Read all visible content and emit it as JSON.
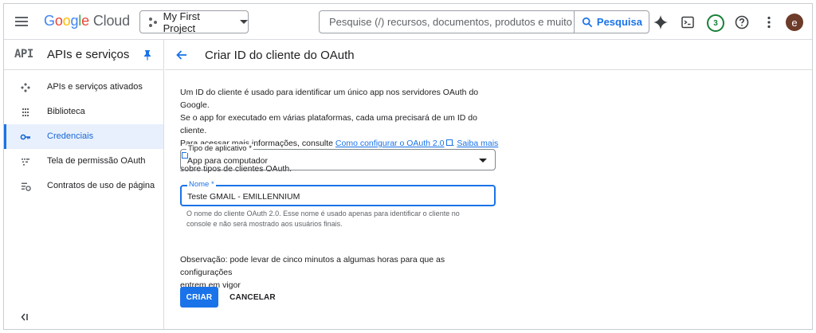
{
  "topbar": {
    "logo_google": [
      "G",
      "o",
      "o",
      "g",
      "l",
      "e"
    ],
    "logo_cloud": "Cloud",
    "project_label": "My First Project",
    "search_placeholder": "Pesquise (/) recursos, documentos, produtos e muito mais",
    "search_button_label": "Pesquisa",
    "notifications_count": "3",
    "avatar_initial": "e"
  },
  "sidebar": {
    "api_badge": "API",
    "title": "APIs e serviços",
    "items": [
      {
        "label": "APIs e serviços ativados",
        "icon": "api-hub-icon",
        "active": false
      },
      {
        "label": "Biblioteca",
        "icon": "library-grid-icon",
        "active": false
      },
      {
        "label": "Credenciais",
        "icon": "key-icon",
        "active": true
      },
      {
        "label": "Tela de permissão OAuth",
        "icon": "consent-screen-icon",
        "active": false
      },
      {
        "label": "Contratos de uso de página",
        "icon": "settings-list-icon",
        "active": false
      }
    ]
  },
  "main": {
    "title": "Criar ID do cliente do OAuth",
    "description": {
      "line1": "Um ID do cliente é usado para identificar um único app nos servidores OAuth do Google.",
      "line2": "Se o app for executado em várias plataformas, cada uma precisará de um ID do cliente.",
      "line3_prefix": "Para acessar mais informações, consulte ",
      "link1": "Como configurar o OAuth 2.0",
      "link2": "Saiba mais",
      "line4": "sobre tipos de clientes OAuth."
    },
    "app_type": {
      "label": "Tipo de aplicativo *",
      "value": "App para computador"
    },
    "name_field": {
      "label": "Nome *",
      "value": "Teste GMAIL - EMILLENNIUM",
      "hint_line1": "O nome do cliente OAuth 2.0. Esse nome é usado apenas para identificar o cliente no",
      "hint_line2": "console e não será mostrado aos usuários finais."
    },
    "note_line1": "Observação: pode levar de cinco minutos a algumas horas para que as configurações",
    "note_line2": "entrem em vigor",
    "create_label": "CRIAR",
    "cancel_label": "CANCELAR"
  },
  "colors": {
    "accent": "#1a73e8",
    "active_bg": "#e8f0fe",
    "badge_green": "#188038",
    "avatar_bg": "#6d3b2a"
  }
}
